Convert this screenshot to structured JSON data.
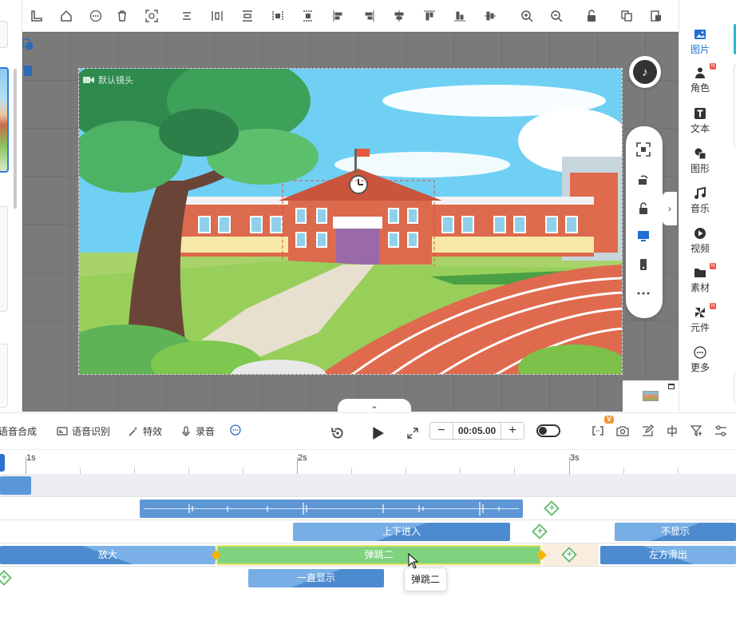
{
  "stage": {
    "camera_label": "默认镜头"
  },
  "right_panel": {
    "items": [
      {
        "label": "图片",
        "icon": "image-icon",
        "active": true,
        "badge": false
      },
      {
        "label": "角色",
        "icon": "person-icon",
        "active": false,
        "badge": true
      },
      {
        "label": "文本",
        "icon": "text-icon",
        "active": false,
        "badge": false
      },
      {
        "label": "图形",
        "icon": "shape-icon",
        "active": false,
        "badge": false
      },
      {
        "label": "音乐",
        "icon": "music-icon",
        "active": false,
        "badge": false
      },
      {
        "label": "视频",
        "icon": "video-icon",
        "active": false,
        "badge": false
      },
      {
        "label": "素材",
        "icon": "folder-icon",
        "active": false,
        "badge": true
      },
      {
        "label": "元件",
        "icon": "pinwheel-icon",
        "active": false,
        "badge": true
      },
      {
        "label": "更多",
        "icon": "more-icon",
        "active": false,
        "badge": false
      }
    ],
    "badge_text": "N"
  },
  "timeline_controls": {
    "tts": "语音合成",
    "asr": "语音识别",
    "effects": "特效",
    "record": "录音",
    "time": "00:05.00",
    "minus": "−",
    "plus": "+",
    "v_badge": "V"
  },
  "ruler": {
    "labels": [
      "1s",
      "2s",
      "3s"
    ]
  },
  "tracks": {
    "track2": {
      "clip_a": "上下进入",
      "clip_b": "不显示"
    },
    "track3": {
      "clip_a": "放大",
      "clip_b": "弹跳二",
      "clip_c": "左方滑出"
    },
    "track4": {
      "clip_a": "一直显示"
    }
  },
  "tooltip": "弹跳二",
  "colors": {
    "accent": "#1f6fd1",
    "clip_blue": "#5b97d8",
    "clip_green": "#7fd37f",
    "add_green": "#6bbd74",
    "keyframe": "#f5b400"
  }
}
